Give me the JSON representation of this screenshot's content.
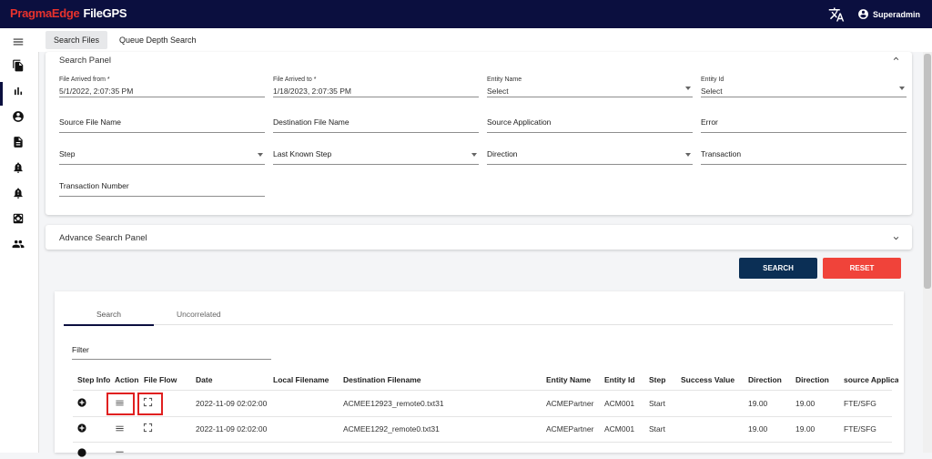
{
  "app": {
    "brand_part1": "PragmaEdge",
    "brand_part2": "FileGPS",
    "user": "Superadmin"
  },
  "colors": {
    "topbar": "#0b0f3f",
    "brand_red": "#e8322d",
    "search_button": "#0b2f55",
    "reset_button": "#f0433a",
    "highlight": "#e02020"
  },
  "sidebar": {
    "icons": [
      "menu-icon",
      "files-icon",
      "bar-chart-icon",
      "account-circle-icon",
      "document-icon",
      "alert-bell-icon",
      "alert-bell-2-icon",
      "center-focus-icon",
      "group-icon"
    ]
  },
  "tabs": [
    "Search Files",
    "Queue Depth Search"
  ],
  "search_panel": {
    "title": "Search Panel",
    "fields": {
      "file_from_label": "File Arrived from *",
      "file_from_value": "5/1/2022, 2:07:35 PM",
      "file_to_label": "File Arrived to *",
      "file_to_value": "1/18/2023, 2:07:35 PM",
      "entity_name_label": "Entity Name",
      "entity_name_value": "Select",
      "entity_id_label": "Entity Id",
      "entity_id_value": "Select",
      "source_file": "Source File Name",
      "dest_file": "Destination File Name",
      "source_app": "Source Application",
      "error": "Error",
      "step": "Step",
      "last_step": "Last Known Step",
      "direction": "Direction",
      "transaction": "Transaction",
      "transaction_number": "Transaction Number"
    }
  },
  "advance_panel": {
    "title": "Advance Search Panel"
  },
  "buttons": {
    "search": "SEARCH",
    "reset": "RESET"
  },
  "results": {
    "tabs": [
      "Search",
      "Uncorrelated"
    ],
    "filter_placeholder": "Filter",
    "columns": [
      "Step Info",
      "Action",
      "File Flow",
      "Date",
      "Local Filename",
      "Destination Filename",
      "Entity Name",
      "Entity Id",
      "Step",
      "Success Value",
      "Direction",
      "Direction",
      "source Applica"
    ],
    "rows": [
      {
        "date": "2022-11-09 02:02:00",
        "dest": "ACMEE12923_remote0.txt31",
        "entity": "ACMEPartner",
        "entity_id": "ACM001",
        "step": "Start",
        "dir1": "19.00",
        "dir2": "19.00",
        "source": "FTE/SFG"
      },
      {
        "date": "2022-11-09 02:02:00",
        "dest": "ACMEE1292_remote0.txt31",
        "entity": "ACMEPartner",
        "entity_id": "ACM001",
        "step": "Start",
        "dir1": "19.00",
        "dir2": "19.00",
        "source": "FTE/SFG"
      }
    ]
  }
}
